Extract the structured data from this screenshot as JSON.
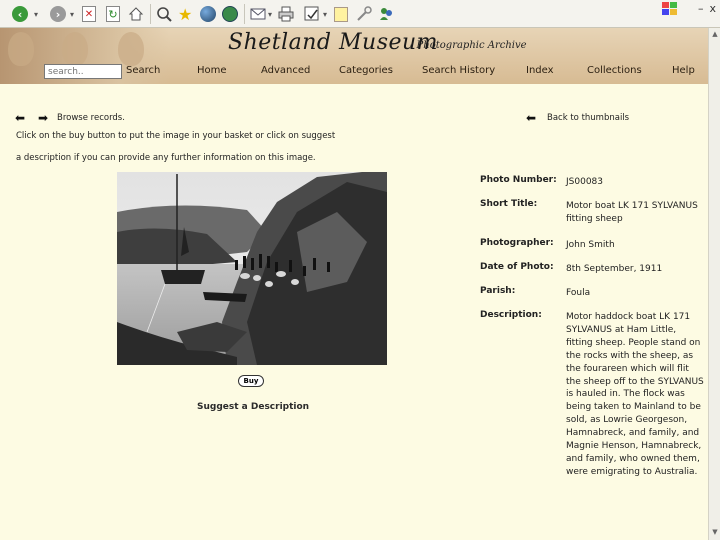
{
  "browser": {
    "window_min": "–",
    "window_close": "x"
  },
  "site": {
    "title": "Shetland Museum",
    "subtitle": "- Photographic Archive",
    "search_placeholder": "search..",
    "search_label": "Search",
    "nav": [
      "Home",
      "Advanced",
      "Categories",
      "Search History",
      "Index",
      "Collections",
      "Help"
    ]
  },
  "content": {
    "browse_label": "Browse records.",
    "back_label": "Back to thumbnails",
    "instructions_line1": "Click on the buy button to put the image in your basket or click on suggest",
    "instructions_line2": "a description if you can provide any further information on this image.",
    "buy_label": "Buy",
    "suggest_label": "Suggest a Description"
  },
  "details": {
    "photo_number_label": "Photo Number:",
    "photo_number": "JS00083",
    "short_title_label": "Short Title:",
    "short_title": [
      "Motor boat LK 171 SYLVANUS",
      "fitting sheep"
    ],
    "photographer_label": "Photographer:",
    "photographer": "John Smith",
    "date_label": "Date of Photo:",
    "date": "8th September, 1911",
    "parish_label": "Parish:",
    "parish": "Foula",
    "description_label": "Description:",
    "description": [
      "Motor haddock boat LK 171",
      "SYLVANUS at Ham Little,",
      "fitting sheep. People stand on",
      "the rocks with the sheep, as",
      "the fourareen which will flit",
      "the sheep off to the SYLVANUS",
      "is hauled in. The flock was",
      "being taken to Mainland to be",
      "sold, as Lowrie Georgeson,",
      "Hamnabreck, and family, and",
      "Magnie Henson, Hamnabreck,",
      "and family, who owned them,",
      "were emigrating to Australia."
    ]
  },
  "icons": {
    "back": "back-arrow-icon",
    "forward": "forward-arrow-icon",
    "stop": "stop-icon",
    "refresh": "refresh-icon",
    "home": "home-icon",
    "search": "search-icon",
    "favorites": "favorites-star-icon",
    "media": "media-icon",
    "history": "history-icon",
    "mail": "mail-icon",
    "print": "print-icon",
    "edit": "edit-icon",
    "note": "note-icon",
    "tools": "tools-icon",
    "messenger": "messenger-icon"
  },
  "colors": {
    "page_bg": "#fdfbe3",
    "header_bg": "#d7bb93"
  }
}
